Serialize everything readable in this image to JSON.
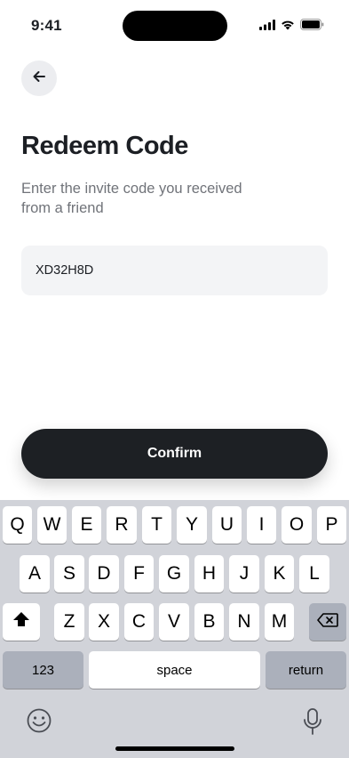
{
  "status_bar": {
    "time": "9:41"
  },
  "header": {
    "back_icon": "arrow-left-icon"
  },
  "page": {
    "title": "Redeem Code",
    "subtitle": "Enter the invite code you received\nfrom a friend"
  },
  "form": {
    "code_value": "XD32H8D",
    "confirm_label": "Confirm"
  },
  "keyboard": {
    "row1": [
      "Q",
      "W",
      "E",
      "R",
      "T",
      "Y",
      "U",
      "I",
      "O",
      "P"
    ],
    "row2": [
      "A",
      "S",
      "D",
      "F",
      "G",
      "H",
      "J",
      "K",
      "L"
    ],
    "row3": [
      "Z",
      "X",
      "C",
      "V",
      "B",
      "N",
      "M"
    ],
    "numbers_label": "123",
    "space_label": "space",
    "return_label": "return"
  }
}
